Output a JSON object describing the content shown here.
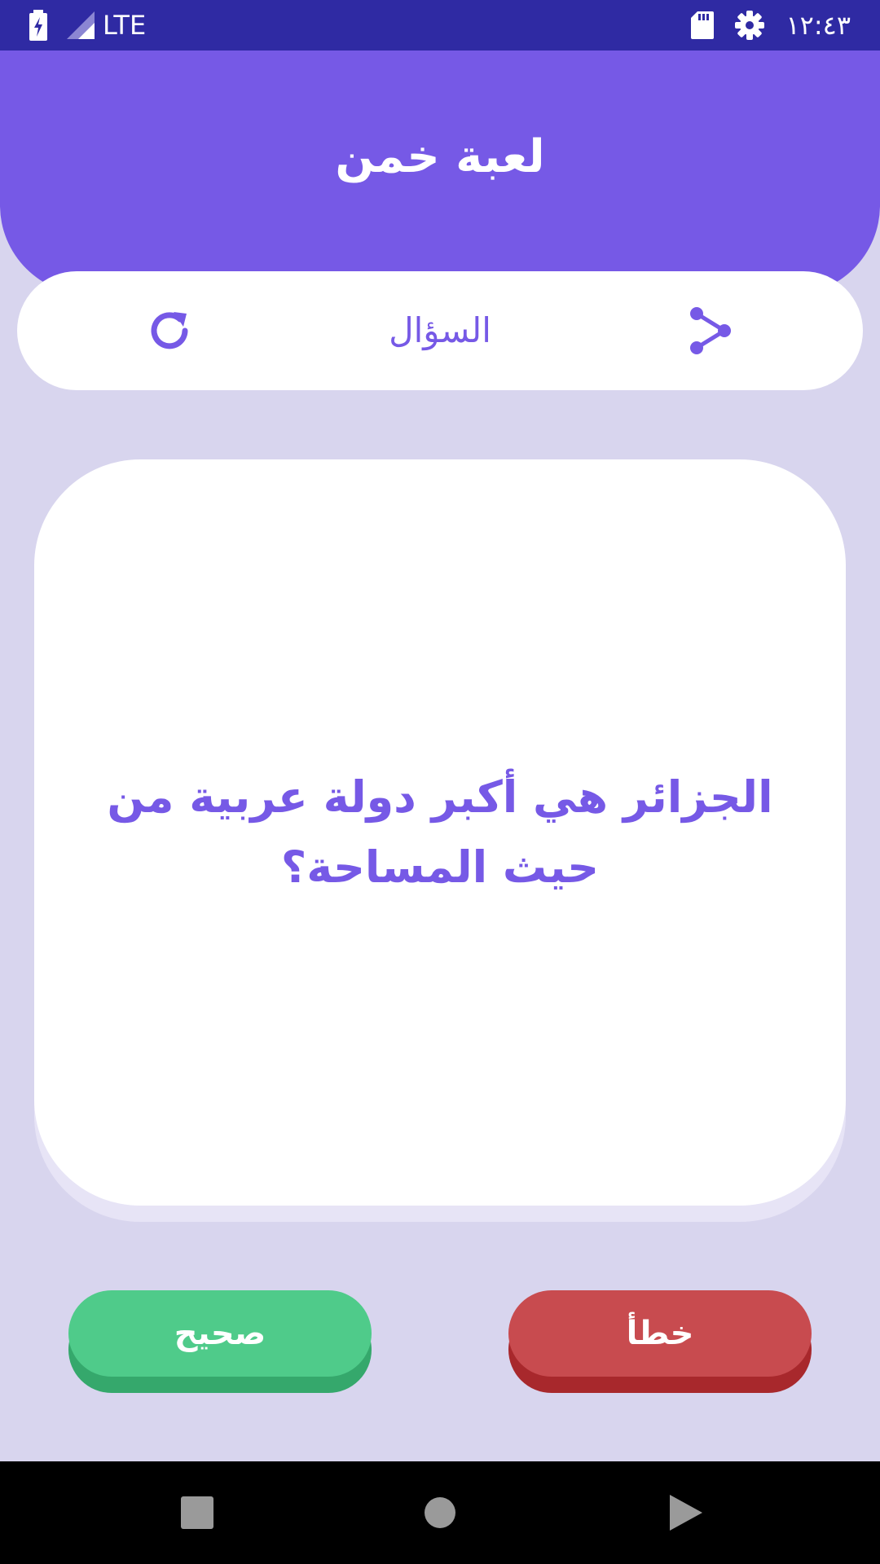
{
  "status_bar": {
    "network": "LTE",
    "time": "١٢:٤٣",
    "icons": [
      "battery-charging-icon",
      "signal-icon",
      "sd-card-icon",
      "settings-gear-icon"
    ]
  },
  "header": {
    "title": "لعبة خمن"
  },
  "toolbar": {
    "label": "السؤال",
    "icons": [
      "refresh-icon",
      "share-icon"
    ]
  },
  "question": {
    "text": "الجزائر هي أكبر دولة عربية من حيث المساحة؟"
  },
  "buttons": {
    "true_label": "صحيح",
    "false_label": "خطأ"
  },
  "colors": {
    "accent": "#7659e6",
    "status_bar": "#2f2aa3",
    "background": "#d8d5ee",
    "true_button": "#4fcb8a",
    "false_button": "#c84b4f"
  },
  "nav_bar": {
    "icons": [
      "recents-square-icon",
      "home-circle-icon",
      "back-triangle-icon"
    ]
  }
}
